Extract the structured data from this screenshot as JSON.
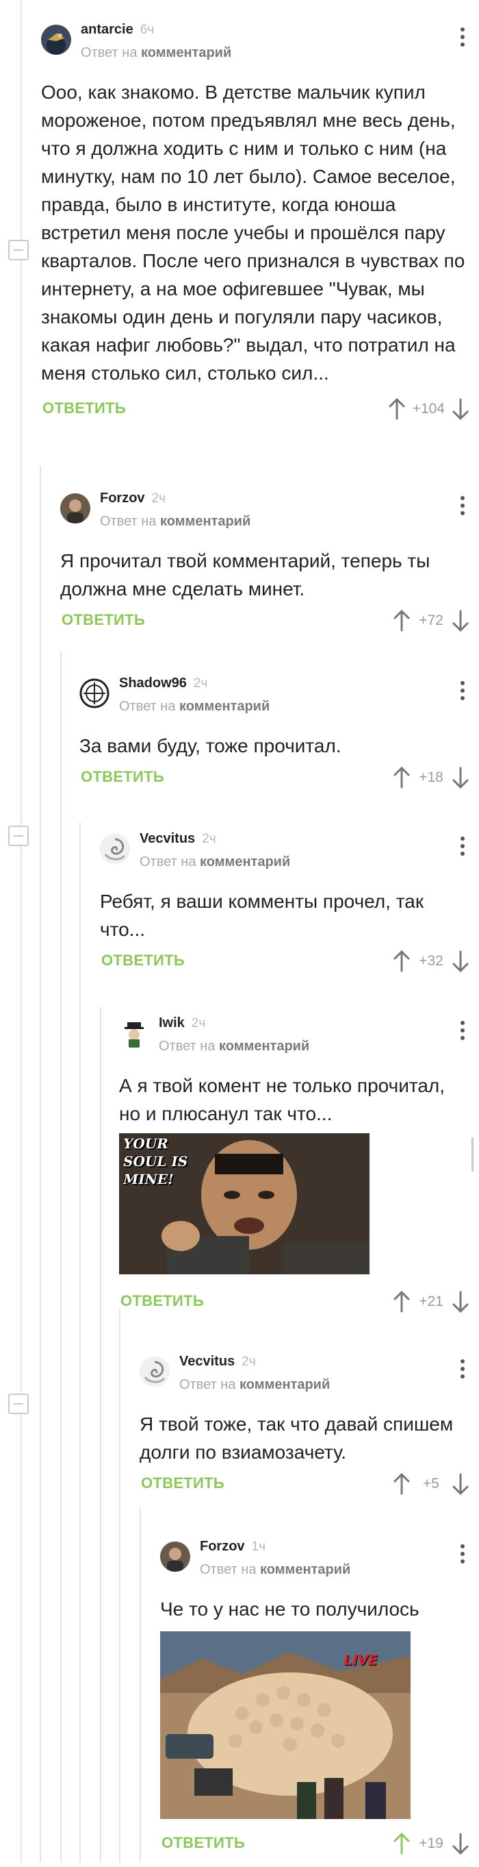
{
  "reply_prefix": "Ответ на",
  "reply_target": "комментарий",
  "reply_button_label": "ОТВЕТИТЬ",
  "colors": {
    "accent_green": "#8ac858",
    "upvoted_green": "#8ac858",
    "muted": "#a8a8a8"
  },
  "comments": [
    {
      "user": "antarcie",
      "time": "6ч",
      "avatar_icon": "avatar-bird-icon",
      "text": "Ооо, как знакомо. В детстве мальчик купил мороженое, потом предъявлял мне весь день, что я должна ходить с ним и только с ним (на минутку, нам по 10 лет было). Самое веселое, правда, было в институте, когда юноша встретил меня после учебы и прошёлся пару кварталов. После чего признался в чувствах по интернету, а на мое офигевшее \"Чувак, мы знакомы один день и погуляли пару часиков, какая нафиг любовь?\" выдал, что потратил на меня столько сил, столько сил...",
      "score": "+104"
    },
    {
      "user": "Forzov",
      "time": "2ч",
      "avatar_icon": "avatar-man-icon",
      "text": "Я прочитал твой комментарий, теперь ты должна мне сделать минет.",
      "score": "+72"
    },
    {
      "user": "Shadow96",
      "time": "2ч",
      "avatar_icon": "avatar-emblem-icon",
      "text": "За вами буду, тоже прочитал.",
      "score": "+18"
    },
    {
      "user": "Vecvitus",
      "time": "2ч",
      "avatar_icon": "avatar-swirl-icon",
      "text": "Ребят, я ваши комменты прочел, так что...",
      "score": "+32"
    },
    {
      "user": "Iwik",
      "time": "2ч",
      "avatar_icon": "avatar-hat-man-icon",
      "text": "А я твой комент не только прочитал, но и плюсанул так что...",
      "image_caption": "YOUR SOUL IS MINE!",
      "score": "+21"
    },
    {
      "user": "Vecvitus",
      "time": "2ч",
      "avatar_icon": "avatar-swirl-icon",
      "text": "Я твой тоже, так что давай спишем долги по взиамозачету.",
      "score": "+5"
    },
    {
      "user": "Forzov",
      "time": "1ч",
      "avatar_icon": "avatar-man-icon",
      "text": "Че то у нас не то получилось",
      "image_caption": "LIVE",
      "score": "+19",
      "upvoted": "yes"
    }
  ]
}
